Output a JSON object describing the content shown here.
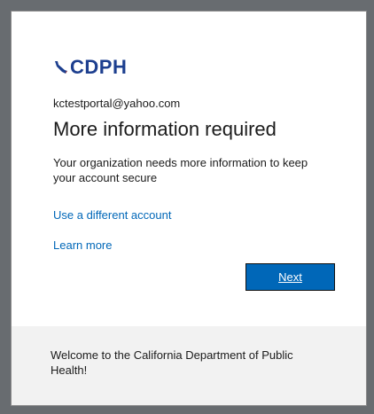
{
  "brand": {
    "logo_text": "CDPH",
    "logo_color": "#1d3f8f",
    "logo_icon": "california-state-icon"
  },
  "account": {
    "email": "kctestportal@yahoo.com"
  },
  "main": {
    "title": "More information required",
    "description": "Your organization needs more information to keep your account secure",
    "use_different_account_link": "Use a different account",
    "learn_more_link": "Learn more",
    "next_button_label": "Next"
  },
  "footer": {
    "message": "Welcome to the California Department of Public Health!"
  },
  "colors": {
    "accent": "#0067b8",
    "background_frame": "#686c70",
    "footer_background": "#f2f2f2"
  }
}
